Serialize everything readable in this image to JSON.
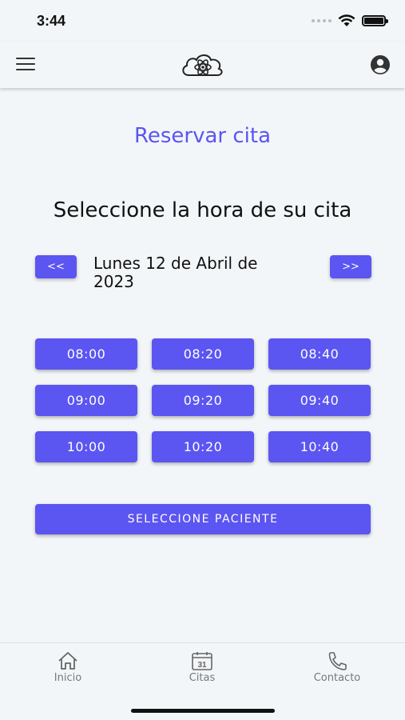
{
  "status_bar": {
    "time": "3:44"
  },
  "header": {
    "menu_icon": "hamburger-menu-icon",
    "logo_icon": "cloud-atom-logo-icon",
    "profile_icon": "user-circle-icon"
  },
  "page": {
    "title": "Reservar cita",
    "subtitle": "Seleccione la hora de su cita",
    "prev_label": "<<",
    "next_label": ">>",
    "date_label": "Lunes 12 de Abril de 2023",
    "time_slots": [
      "08:00",
      "08:20",
      "08:40",
      "09:00",
      "09:20",
      "09:40",
      "10:00",
      "10:20",
      "10:40"
    ],
    "patient_button": "SELECCIONE PACIENTE"
  },
  "tabbar": {
    "items": [
      {
        "label": "Inicio",
        "icon": "home-icon"
      },
      {
        "label": "Citas",
        "icon": "calendar-icon",
        "icon_text": "31"
      },
      {
        "label": "Contacto",
        "icon": "phone-icon"
      }
    ]
  },
  "colors": {
    "accent": "#5b55f2",
    "background": "#f3f6f8",
    "tab_label": "#777777"
  }
}
